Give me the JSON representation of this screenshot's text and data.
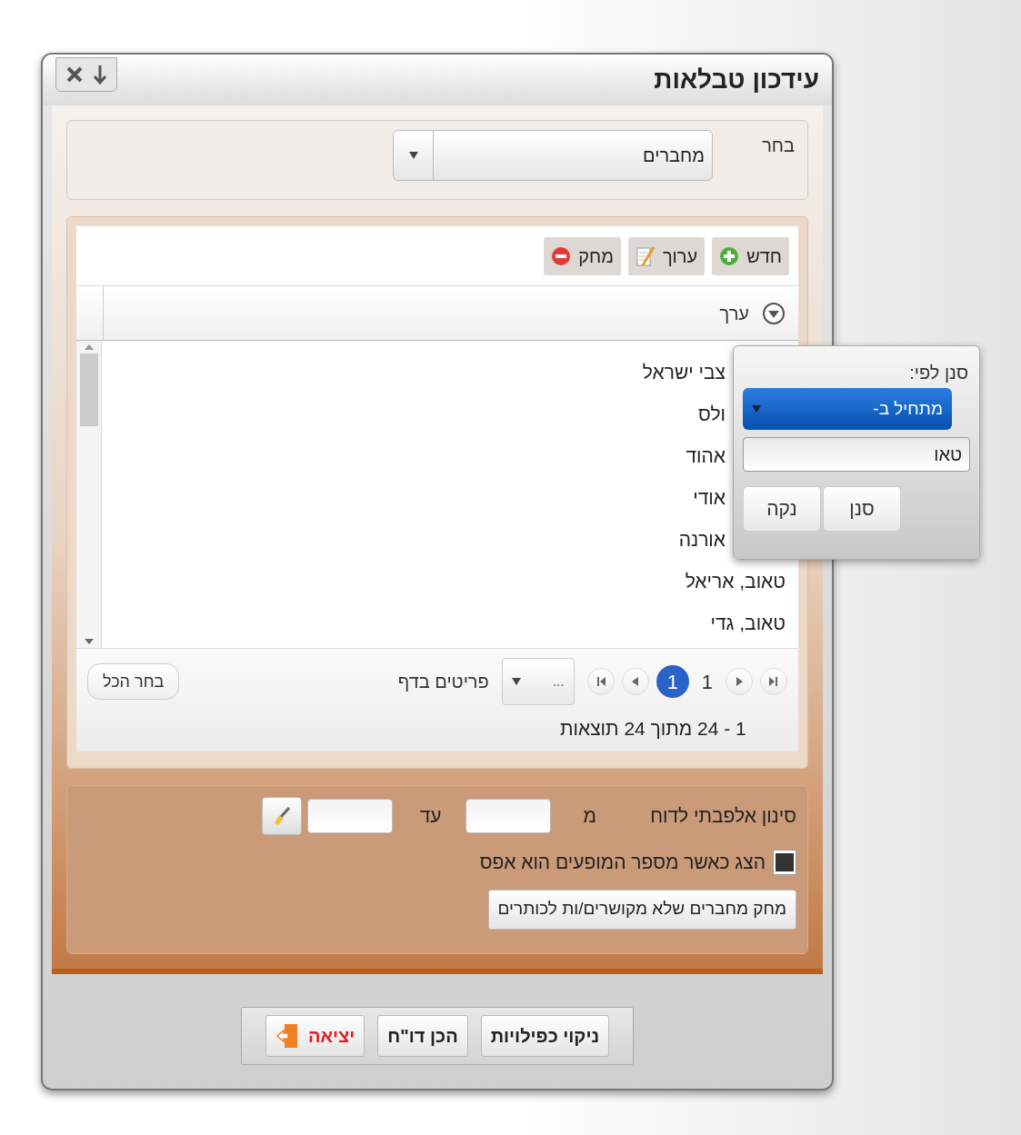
{
  "window": {
    "title": "עידכון טבלאות"
  },
  "select": {
    "label": "בחר",
    "value": "מחברים"
  },
  "toolbar": [
    {
      "label": "חדש",
      "kind": "add"
    },
    {
      "label": "ערוך",
      "kind": "edit"
    },
    {
      "label": "מחק",
      "kind": "delete"
    }
  ],
  "grid": {
    "column": "ערך",
    "rows": [
      {
        "text": "צבי ישראל",
        "covered": true
      },
      {
        "text": "ולס",
        "covered": true
      },
      {
        "text": "אהוד",
        "covered": true
      },
      {
        "text": "אודי",
        "covered": true
      },
      {
        "text": "אורנה",
        "covered": true
      },
      {
        "text": "טאוב, אריאל",
        "covered": false
      },
      {
        "text": "טאוב, גדי",
        "covered": false
      }
    ]
  },
  "pager": {
    "pages": [
      {
        "label": "1",
        "selected": true
      }
    ],
    "page_text": "1",
    "page_size": "...",
    "page_size_label": "פריטים בדף",
    "select_all": "בחר הכל",
    "summary": "1 - 24 מתוך 24 תוצאות"
  },
  "filter_popup": {
    "label": "סנן לפי:",
    "operator": "מתחיל ב-",
    "value": "טאו",
    "buttons": [
      "סנן",
      "נקה"
    ]
  },
  "alpha_filter": {
    "label": "סינון אלפבתי לדוח",
    "from_label": "מ",
    "to_label": "עד"
  },
  "show_zero": {
    "label": "הצג כאשר מספר המופעים הוא אפס",
    "checked": true
  },
  "delete_unlinked": "מחק מחברים שלא מקושרים/ות לכותרים",
  "footer_buttons": [
    {
      "label": "ניקוי כפילויות",
      "kind": "plain"
    },
    {
      "label": "הכן דו\"ח",
      "kind": "plain"
    },
    {
      "label": "יציאה",
      "kind": "exit"
    }
  ]
}
